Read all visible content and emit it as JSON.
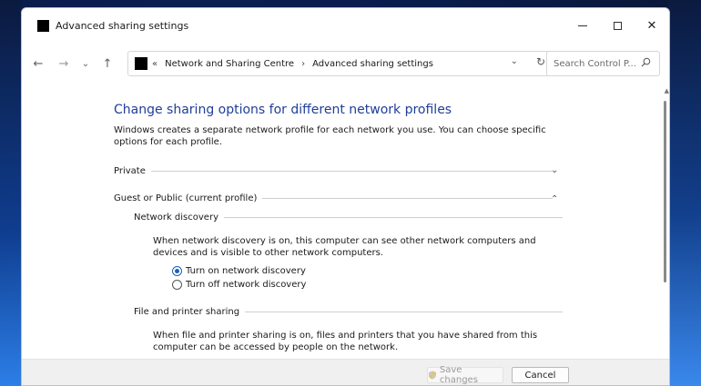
{
  "window": {
    "title": "Advanced sharing settings",
    "controls": {
      "minimize": "",
      "maximize": "",
      "close": "✕"
    }
  },
  "nav": {
    "back": "←",
    "forward": "→",
    "recent": "⌄",
    "up": "↑"
  },
  "address": {
    "overflow": "«",
    "crumbs": [
      "Network and Sharing Centre",
      "Advanced sharing settings"
    ],
    "separator": "›",
    "dropdown": "⌄",
    "refresh": "↻"
  },
  "search": {
    "placeholder": "Search Control P..."
  },
  "main": {
    "heading": "Change sharing options for different network profiles",
    "intro": "Windows creates a separate network profile for each network you use. You can choose specific options for each profile.",
    "profiles": [
      {
        "label": "Private",
        "expanded": false,
        "chevron": "⌄"
      },
      {
        "label": "Guest or Public (current profile)",
        "expanded": true,
        "chevron": "⌃"
      }
    ],
    "network_discovery": {
      "label": "Network discovery",
      "description": "When network discovery is on, this computer can see other network computers and devices and is visible to other network computers.",
      "options": [
        {
          "label": "Turn on network discovery",
          "selected": true
        },
        {
          "label": "Turn off network discovery",
          "selected": false
        }
      ]
    },
    "file_printer_sharing": {
      "label": "File and printer sharing",
      "description": "When file and printer sharing is on, files and printers that you have shared from this computer can be accessed by people on the network."
    }
  },
  "footer": {
    "save_label": "Save changes",
    "cancel_label": "Cancel"
  },
  "colors": {
    "heading": "#1f3e99",
    "accent": "#1d5fb8"
  }
}
